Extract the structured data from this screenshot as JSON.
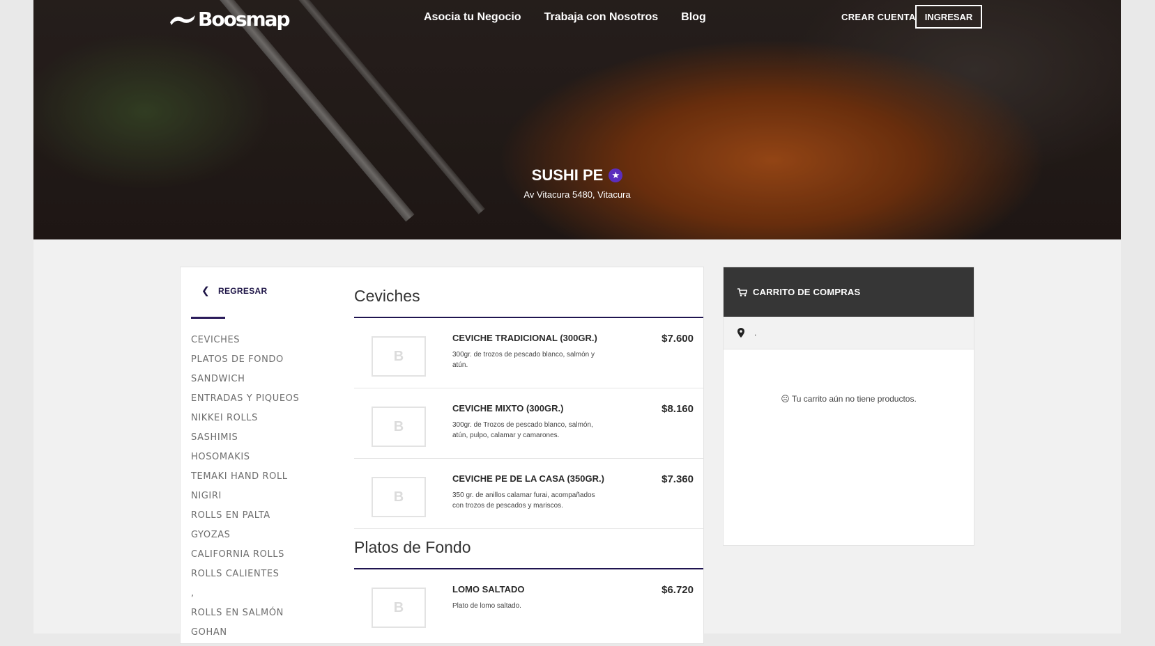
{
  "header": {
    "logo": "Boosmap",
    "nav": [
      "Asocia tu Negocio",
      "Trabaja con Nosotros",
      "Blog"
    ],
    "crear_cuenta": "CREAR CUENTA",
    "ingresar": "INGRESAR"
  },
  "store": {
    "name": "SUSHI PE",
    "address": "Av Vitacura 5480, Vitacura"
  },
  "sidebar": {
    "back_label": "REGRESAR",
    "categories": [
      "CEVICHES",
      "PLATOS DE FONDO",
      "SANDWICH",
      "ENTRADAS Y PIQUEOS",
      "NIKKEI ROLLS",
      "SASHIMIS",
      "HOSOMAKIS",
      "TEMAKI HAND ROLL",
      "NIGIRI",
      "ROLLS EN PALTA",
      "GYOZAS",
      "CALIFORNIA ROLLS",
      "ROLLS CALIENTES",
      ",",
      "ROLLS EN SALMÓN",
      "GOHAN"
    ]
  },
  "sections": [
    {
      "title": "Ceviches",
      "items": [
        {
          "name": "CEVICHE TRADICIONAL (300GR.)",
          "desc": "300gr. de trozos de pescado blanco, salmón y atún.",
          "price": "$7.600"
        },
        {
          "name": "CEVICHE MIXTO (300GR.)",
          "desc": "300gr. de Trozos de pescado blanco, salmón, atún, pulpo, calamar y camarones.",
          "price": "$8.160"
        },
        {
          "name": "CEVICHE PE DE LA CASA (350GR.)",
          "desc": "350 gr. de anillos calamar furai, acompañados con trozos de pescados y mariscos.",
          "price": "$7.360"
        }
      ]
    },
    {
      "title": "Platos de Fondo",
      "items": [
        {
          "name": "LOMO SALTADO",
          "desc": "Plato de lomo saltado.",
          "price": "$6.720"
        }
      ]
    }
  ],
  "thumb_placeholder": "B",
  "cart": {
    "title": "CARRITO DE COMPRAS",
    "address": ".",
    "empty_text": "☹ Tu carrito aún no tiene productos."
  },
  "colors": {
    "accent": "#1f1450",
    "badge": "#5b2ebd",
    "cart_header": "#363636"
  }
}
